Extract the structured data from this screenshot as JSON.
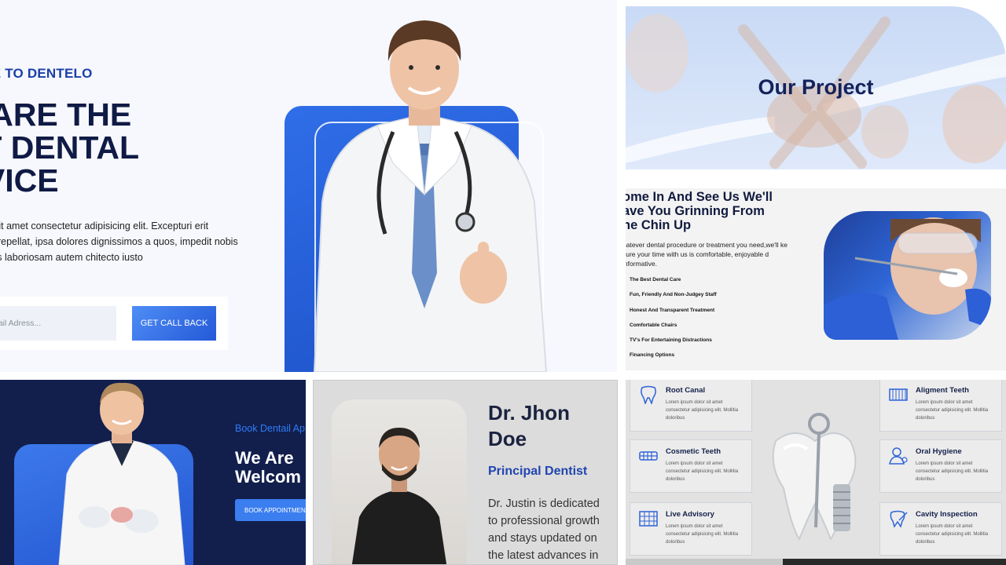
{
  "hero": {
    "eyebrow": "OME TO DENTELO",
    "headline": [
      "E ARE THE",
      "ST DENTAL",
      "RVICE"
    ],
    "description": "um dolor sit amet consectetur adipisicing elit. Excepturi erit obcaecati repellat, ipsa dolores dignissimos a quos, impedit nobis perferendis laboriosam autem chitecto iusto",
    "email_placeholder": "nail Adress...",
    "cta_label": "GET CALL BACK"
  },
  "project": {
    "title": "Our Project"
  },
  "smile": {
    "heading": [
      "ome In And See Us We'll",
      "ave You Grinning From",
      "he Chin Up"
    ],
    "text": "hatever dental procedure or treatment you need,we'll ke sure your time with us is comfortable, enjoyable d informative.",
    "features": [
      "The Best Dental Care",
      "Fun, Friendly And Non-Judgey Staff",
      "Honest And Transparent Treatment",
      "Comfortable Chairs",
      "TV's For Entertaining Distractions",
      "Financing Options"
    ]
  },
  "intro": {
    "pretitle": "Book Dentail Ap",
    "title": [
      "We Are",
      "Welcom"
    ],
    "button_label": "BOOK APPOINTMENT"
  },
  "profile": {
    "name": [
      "Dr. Jhon",
      "Doe"
    ],
    "role": "Principal Dentist",
    "bio": "Dr. Justin is dedicated to professional growth and stays updated on the latest advances in"
  },
  "services": {
    "items": [
      {
        "title": "Root Canal",
        "desc": "Lorem ipsum dolor sit amet consectetur adipisicing elit. Mollitia doloribus",
        "icon": "tooth-icon"
      },
      {
        "title": "Cosmetic Teeth",
        "desc": "Lorem ipsum dolor sit amet consectetur adipisicing elit. Mollitia doloribus",
        "icon": "braces-icon"
      },
      {
        "title": "Live Advisory",
        "desc": "Lorem ipsum dolor sit amet consectetur adipisicing elit. Mollitia doloribus",
        "icon": "teeth-chart-icon"
      },
      {
        "title": "Aligment Teeth",
        "desc": "Lorem ipsum dolor sit amet consectetur adipisicing elit. Mollitia doloribus",
        "icon": "aligner-icon"
      },
      {
        "title": "Oral Hygiene",
        "desc": "Lorem ipsum dolor sit amet consectetur adipisicing elit. Mollitia doloribus",
        "icon": "dentist-icon"
      },
      {
        "title": "Cavity Inspection",
        "desc": "Lorem ipsum dolor sit amet consectetur adipisicing elit. Mollitia doloribus",
        "icon": "inspection-icon"
      }
    ]
  },
  "colors": {
    "brand_blue": "#2459d8",
    "navy": "#0f1a45",
    "accent_blue": "#2145b0"
  }
}
